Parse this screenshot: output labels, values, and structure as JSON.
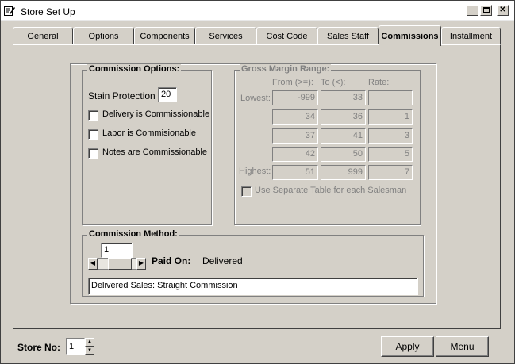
{
  "window": {
    "title": "Store Set Up"
  },
  "tabs": [
    {
      "label": "General"
    },
    {
      "label": "Options"
    },
    {
      "label": "Components"
    },
    {
      "label": "Services"
    },
    {
      "label": "Cost Code"
    },
    {
      "label": "Sales Staff"
    },
    {
      "label": "Commissions"
    },
    {
      "label": "Installment"
    }
  ],
  "commission_options": {
    "title": "Commission Options:",
    "stain_label": "Stain Protection %",
    "stain_value": "20",
    "delivery_label": "Delivery is Commissionable",
    "labor_label": "Labor is Commisionable",
    "notes_label": "Notes are Commissionable"
  },
  "gross_margin": {
    "title": "Gross Margin Range:",
    "col_from": "From (>=):",
    "col_to": "To (<):",
    "col_rate": "Rate:",
    "lowest_label": "Lowest:",
    "highest_label": "Highest:",
    "rows": [
      {
        "from": "-999",
        "to": "33",
        "rate": ""
      },
      {
        "from": "34",
        "to": "36",
        "rate": "1"
      },
      {
        "from": "37",
        "to": "41",
        "rate": "3"
      },
      {
        "from": "42",
        "to": "50",
        "rate": "5"
      },
      {
        "from": "51",
        "to": "999",
        "rate": "7"
      }
    ],
    "separate_table_label": "Use Separate Table for each Salesman"
  },
  "commission_method": {
    "title": "Commission Method:",
    "value": "1",
    "paid_on_label": "Paid On:",
    "paid_on_value": "Delivered",
    "description": "Delivered Sales: Straight Commission"
  },
  "footer": {
    "store_label": "Store No:",
    "store_value": "1",
    "apply_label": "Apply",
    "menu_label": "Menu"
  }
}
